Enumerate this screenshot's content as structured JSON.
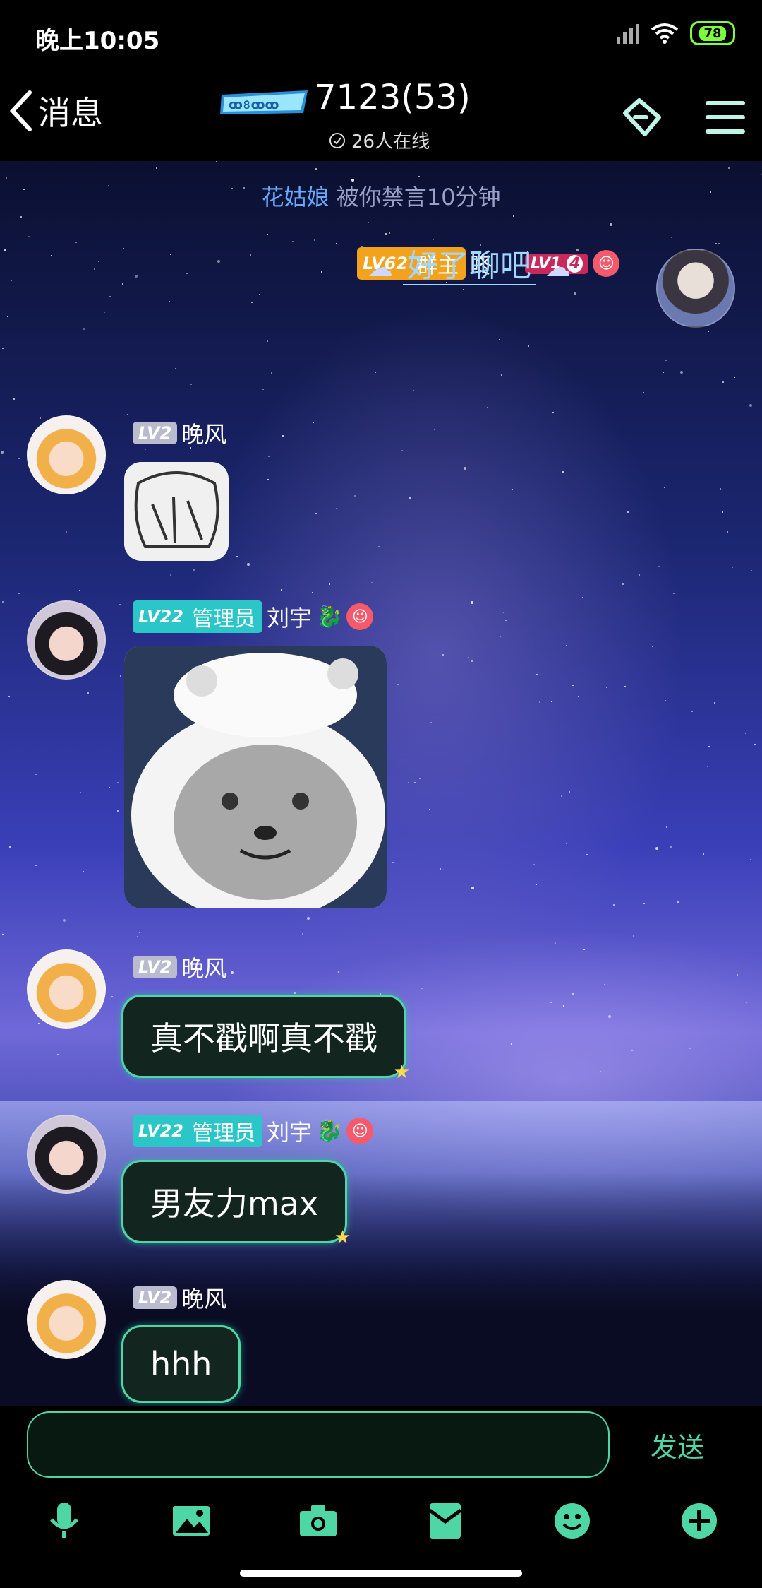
{
  "status": {
    "time": "晚上10:05",
    "battery": "78"
  },
  "nav": {
    "back_label": "消息",
    "title": "7123(53)",
    "online": "26人在线"
  },
  "system_message": {
    "name": "花姑娘",
    "text": "被你禁言10分钟"
  },
  "messages": [
    {
      "level": "LV62",
      "role": "群主",
      "sender": "咚",
      "badge": "LV1",
      "badge_num": "4",
      "text": "好了聊吧"
    },
    {
      "level": "LV2",
      "sender": "晚风"
    },
    {
      "level": "LV22",
      "role": "管理员",
      "sender": "刘宇"
    },
    {
      "level": "LV2",
      "sender": "晚风",
      "text": "真不戳啊真不戳"
    },
    {
      "level": "LV22",
      "role": "管理员",
      "sender": "刘宇",
      "text": "男友力max"
    },
    {
      "level": "LV2",
      "sender": "晚风",
      "text": "hhh"
    }
  ],
  "input": {
    "placeholder": "",
    "send_label": "发送"
  },
  "toolbar": [
    "microphone-icon",
    "image-icon",
    "camera-icon",
    "red-packet-icon",
    "emoji-icon",
    "plus-icon"
  ],
  "colors": {
    "accent": "#4fd6a6",
    "admin": "#2ac6c8",
    "owner": "#f2a21c"
  }
}
